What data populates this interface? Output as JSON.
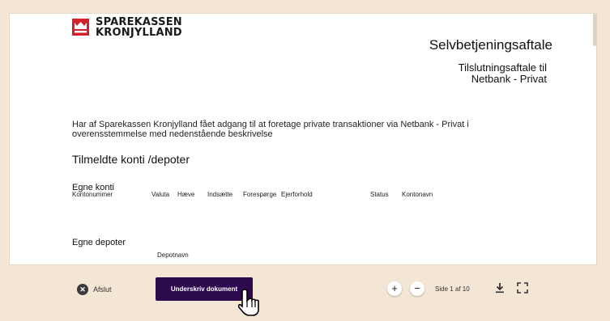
{
  "document": {
    "logo_line1": "SPAREKASSEN",
    "logo_line2": "KRONJYLLAND",
    "title": "Selvbetjeningsaftale",
    "subtitle_line1": "Tilslutningsaftale til",
    "subtitle_line2": "Netbank - Privat",
    "intro_line1": "Har af Sparekassen Kronjylland fået adgang til at foretage private transaktioner via Netbank - Privat i",
    "intro_line2": "overensstemmelse med nedenstående beskrivelse",
    "section_title": "Tilmeldte konti /depoter",
    "accounts_heading": "Egne konti",
    "columns": [
      "Kontonummer",
      "Valuta",
      "Hæve",
      "Indsætte",
      "Forespørge",
      "Ejerforhold",
      "Status",
      "Kontonavn"
    ],
    "depots_heading": "Egne depoter",
    "depot_column": "Depotnavn"
  },
  "toolbar": {
    "close_label": "Afslut",
    "sign_label": "Underskriv dokument",
    "zoom_in": "+",
    "zoom_out": "−",
    "page_indicator": "Side 1 af 10"
  },
  "icons": {
    "close": "x-circle-icon",
    "download": "download-icon",
    "fullscreen": "fullscreen-icon",
    "cursor": "hand-pointer-cursor"
  },
  "colors": {
    "background": "#f3e6d5",
    "brand_red": "#d4202b",
    "sign_button": "#2d0a4e"
  }
}
